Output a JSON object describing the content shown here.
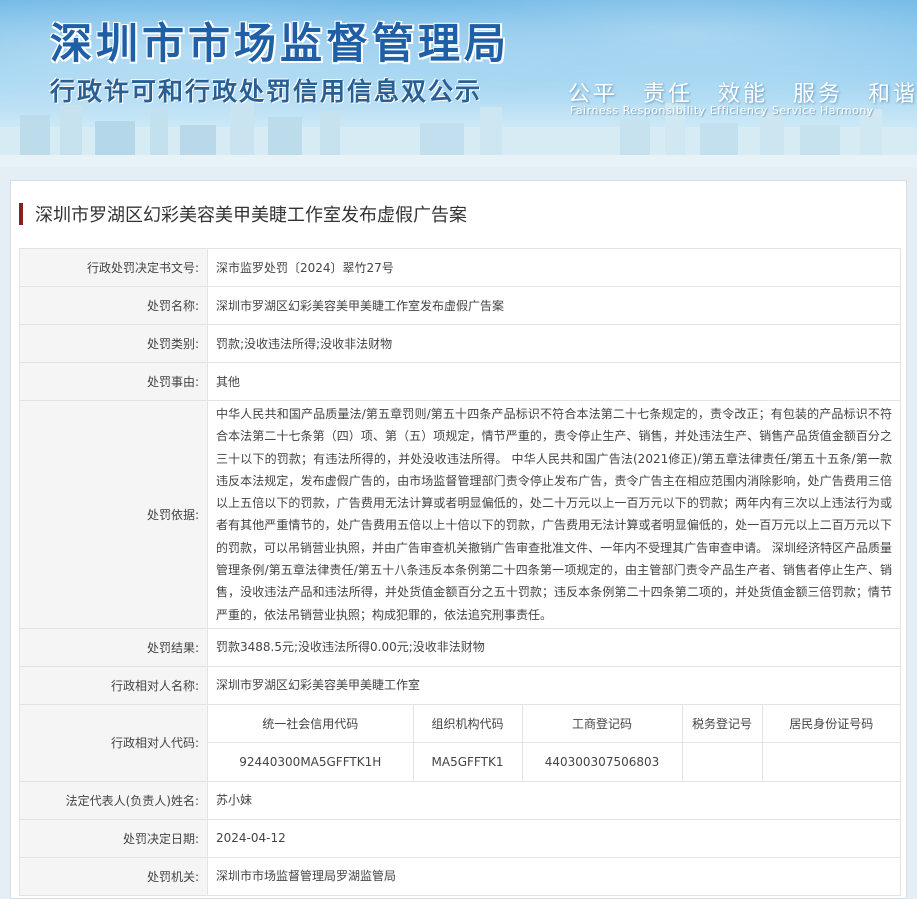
{
  "header": {
    "title": "深圳市市场监督管理局",
    "subtitle": "行政许可和行政处罚信用信息双公示",
    "motto": "公平　责任　效能　服务　和谐",
    "motto_en": "Fairness  Responsibility  Efficiency  Service  Harmony"
  },
  "case": {
    "title": "深圳市罗湖区幻彩美容美甲美睫工作室发布虚假广告案"
  },
  "fields": {
    "decision_no": {
      "label": "行政处罚决定书文号:",
      "value": "深市监罗处罚〔2024〕翠竹27号"
    },
    "name": {
      "label": "处罚名称:",
      "value": "深圳市罗湖区幻彩美容美甲美睫工作室发布虚假广告案"
    },
    "category": {
      "label": "处罚类别:",
      "value": "罚款;没收违法所得;没收非法财物"
    },
    "reason": {
      "label": "处罚事由:",
      "value": "其他"
    },
    "basis": {
      "label": "处罚依据:",
      "value": "中华人民共和国产品质量法/第五章罚则/第五十四条产品标识不符合本法第二十七条规定的，责令改正；有包装的产品标识不符合本法第二十七条第（四）项、第（五）项规定，情节严重的，责令停止生产、销售，并处违法生产、销售产品货值金额百分之三十以下的罚款；有违法所得的，并处没收违法所得。 中华人民共和国广告法(2021修正)/第五章法律责任/第五十五条/第一款违反本法规定，发布虚假广告的，由市场监督管理部门责令停止发布广告，责令广告主在相应范围内消除影响，处广告费用三倍以上五倍以下的罚款，广告费用无法计算或者明显偏低的，处二十万元以上一百万元以下的罚款；两年内有三次以上违法行为或者有其他严重情节的，处广告费用五倍以上十倍以下的罚款，广告费用无法计算或者明显偏低的，处一百万元以上二百万元以下的罚款，可以吊销营业执照，并由广告审查机关撤销广告审查批准文件、一年内不受理其广告审查申请。 深圳经济特区产品质量管理条例/第五章法律责任/第五十八条违反本条例第二十四条第一项规定的，由主管部门责令产品生产者、销售者停止生产、销售，没收违法产品和违法所得，并处货值金额百分之五十罚款；违反本条例第二十四条第二项的，并处货值金额三倍罚款；情节严重的，依法吊销营业执照；构成犯罪的，依法追究刑事责任。"
    },
    "result": {
      "label": "处罚结果:",
      "value": "罚款3488.5元;没收违法所得0.00元;没收非法财物"
    },
    "party_name": {
      "label": "行政相对人名称:",
      "value": "深圳市罗湖区幻彩美容美甲美睫工作室"
    },
    "party_code": {
      "label": "行政相对人代码:",
      "headers": [
        "统一社会信用代码",
        "组织机构代码",
        "工商登记码",
        "税务登记号",
        "居民身份证号码"
      ],
      "values": [
        "92440300MA5GFFTK1H",
        "MA5GFFTK1",
        "440300307506803",
        "",
        ""
      ]
    },
    "legal_rep": {
      "label": "法定代表人(负责人)姓名:",
      "value": "苏小妹"
    },
    "decision_date": {
      "label": "处罚决定日期:",
      "value": "2024-04-12"
    },
    "authority": {
      "label": "处罚机关:",
      "value": "深圳市市场监督管理局罗湖监管局"
    }
  }
}
